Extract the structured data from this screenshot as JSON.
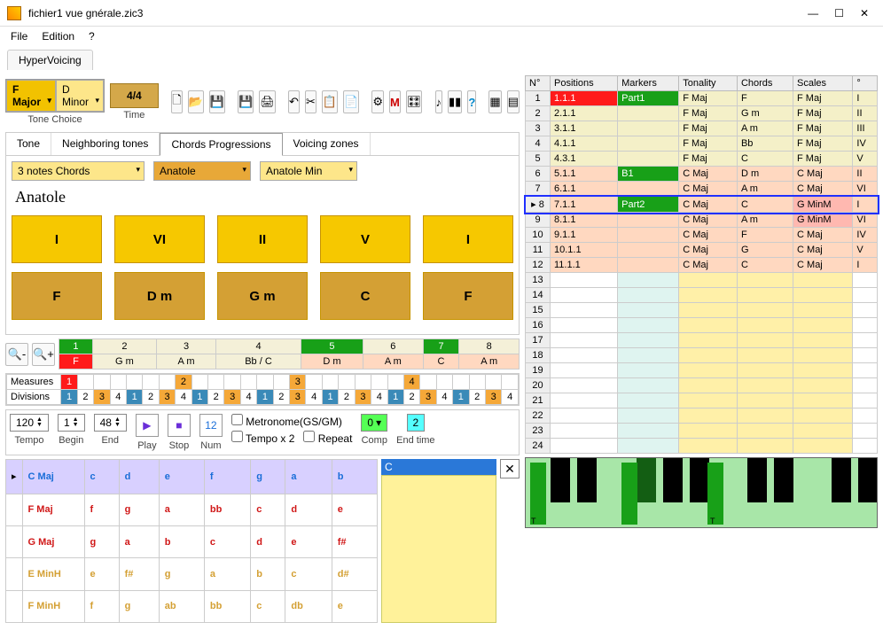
{
  "window": {
    "title": "fichier1 vue gnérale.zic3"
  },
  "menu": {
    "file": "File",
    "edition": "Edition",
    "help": "?"
  },
  "mainTab": "HyperVoicing",
  "toolbar": {
    "tone_choice": "F Major",
    "relative": "D Minor",
    "tone_label": "Tone Choice",
    "time_sig": "4/4",
    "time_label": "Time"
  },
  "tabs2": [
    "Tone",
    "Neighboring tones",
    "Chords Progressions",
    "Voicing zones"
  ],
  "selectors": {
    "chord_type": "3 notes Chords",
    "prog1": "Anatole",
    "prog2": "Anatole Min"
  },
  "anatole": "Anatole",
  "row1": [
    "I",
    "VI",
    "II",
    "V",
    "I"
  ],
  "row2": [
    "F",
    "D m",
    "G m",
    "C",
    "F"
  ],
  "prog": {
    "headers": [
      "1",
      "2",
      "3",
      "4",
      "5",
      "6",
      "7",
      "8"
    ],
    "chords": [
      "F",
      "G m",
      "A m",
      "Bb / C",
      "D m",
      "A m",
      "C",
      "A m"
    ],
    "green": [
      1,
      5,
      7
    ]
  },
  "measdiv": {
    "measures_label": "Measures",
    "divisions_label": "Divisions",
    "measures": [
      "1",
      "",
      "",
      "",
      "",
      "",
      "",
      "2",
      "",
      "",
      "",
      "",
      "",
      "",
      "3",
      "",
      "",
      "",
      "",
      "",
      "",
      "4",
      "",
      "",
      "",
      "",
      "",
      ""
    ],
    "divisions": [
      "1",
      "2",
      "3",
      "4",
      "1",
      "2",
      "3",
      "4",
      "1",
      "2",
      "3",
      "4",
      "1",
      "2",
      "3",
      "4",
      "1",
      "2",
      "3",
      "4",
      "1",
      "2",
      "3",
      "4",
      "1",
      "2",
      "3",
      "4"
    ]
  },
  "transport": {
    "tempo_val": "120",
    "tempo_lbl": "Tempo",
    "begin_val": "1",
    "begin_lbl": "Begin",
    "end_val": "48",
    "end_lbl": "End",
    "play_lbl": "Play",
    "stop_lbl": "Stop",
    "num_val": "12",
    "num_lbl": "Num",
    "metronome": "Metronome(GS/GM)",
    "tempox2": "Tempo x 2",
    "repeat": "Repeat",
    "comp_val": "0",
    "comp_lbl": "Comp",
    "endtime_val": "2",
    "endtime_lbl": "End time"
  },
  "chord_notes": [
    {
      "name": "C Maj",
      "color": "#1a6ed8",
      "notes": [
        "c",
        "d",
        "e",
        "f",
        "g",
        "a",
        "b"
      ]
    },
    {
      "name": "F Maj",
      "color": "#d01818",
      "notes": [
        "f",
        "g",
        "a",
        "bb",
        "c",
        "d",
        "e"
      ]
    },
    {
      "name": "G Maj",
      "color": "#d01818",
      "notes": [
        "g",
        "a",
        "b",
        "c",
        "d",
        "e",
        "f#"
      ]
    },
    {
      "name": "E MinH",
      "color": "#d4a034",
      "notes": [
        "e",
        "f#",
        "g",
        "a",
        "b",
        "c",
        "d#"
      ]
    },
    {
      "name": "F MinH",
      "color": "#d4a034",
      "notes": [
        "f",
        "g",
        "ab",
        "bb",
        "c",
        "db",
        "e"
      ]
    }
  ],
  "note_panel": "C",
  "table": {
    "headers": [
      "N°",
      "Positions",
      "Markers",
      "Tonality",
      "Chords",
      "Scales",
      "°"
    ],
    "rows": [
      {
        "n": 1,
        "pos": "1.1.1",
        "marker": "Part1",
        "ton": "F Maj",
        "chord": "F",
        "scale": "F Maj",
        "deg": "I",
        "posbg": "#ff1a1a",
        "markbg": "#18a018"
      },
      {
        "n": 2,
        "pos": "2.1.1",
        "marker": "",
        "ton": "F Maj",
        "chord": "G m",
        "scale": "F Maj",
        "deg": "II"
      },
      {
        "n": 3,
        "pos": "3.1.1",
        "marker": "",
        "ton": "F Maj",
        "chord": "A m",
        "scale": "F Maj",
        "deg": "III"
      },
      {
        "n": 4,
        "pos": "4.1.1",
        "marker": "",
        "ton": "F Maj",
        "chord": "Bb",
        "scale": "F Maj",
        "deg": "IV"
      },
      {
        "n": 5,
        "pos": "4.3.1",
        "marker": "",
        "ton": "F Maj",
        "chord": "C",
        "scale": "F Maj",
        "deg": "V"
      },
      {
        "n": 6,
        "pos": "5.1.1",
        "marker": "B1",
        "ton": "C Maj",
        "chord": "D m",
        "scale": "C Maj",
        "deg": "II",
        "markbg": "#18a018"
      },
      {
        "n": 7,
        "pos": "6.1.1",
        "marker": "",
        "ton": "C Maj",
        "chord": "A m",
        "scale": "C Maj",
        "deg": "VI"
      },
      {
        "n": 8,
        "pos": "7.1.1",
        "marker": "Part2",
        "ton": "C Maj",
        "chord": "C",
        "scale": "G MinM",
        "deg": "I",
        "markbg": "#18a018",
        "sel": true
      },
      {
        "n": 9,
        "pos": "8.1.1",
        "marker": "",
        "ton": "C Maj",
        "chord": "A m",
        "scale": "G MinM",
        "deg": "VI"
      },
      {
        "n": 10,
        "pos": "9.1.1",
        "marker": "",
        "ton": "C Maj",
        "chord": "F",
        "scale": "C Maj",
        "deg": "IV"
      },
      {
        "n": 11,
        "pos": "10.1.1",
        "marker": "",
        "ton": "C Maj",
        "chord": "G",
        "scale": "C Maj",
        "deg": "V"
      },
      {
        "n": 12,
        "pos": "11.1.1",
        "marker": "",
        "ton": "C Maj",
        "chord": "C",
        "scale": "C Maj",
        "deg": "I"
      },
      {
        "n": 13
      },
      {
        "n": 14
      },
      {
        "n": 15
      },
      {
        "n": 16
      },
      {
        "n": 17
      },
      {
        "n": 18
      },
      {
        "n": 19
      },
      {
        "n": 20
      },
      {
        "n": 21
      },
      {
        "n": 22
      },
      {
        "n": 23
      },
      {
        "n": 24
      }
    ]
  }
}
